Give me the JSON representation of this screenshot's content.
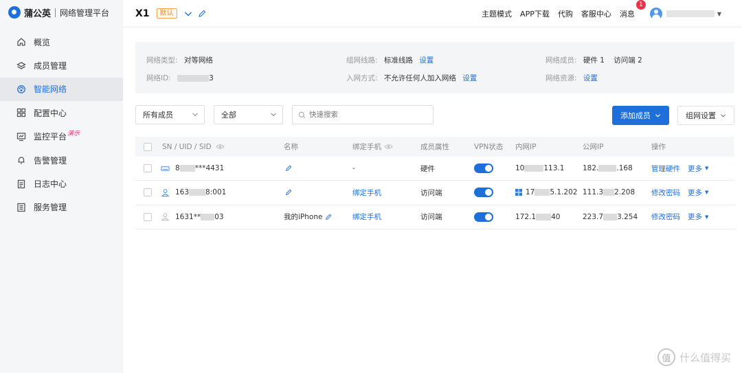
{
  "brand": {
    "name": "蒲公英",
    "subtitle": "网络管理平台"
  },
  "sidebar": {
    "items": [
      {
        "label": "概览",
        "icon": "home-icon"
      },
      {
        "label": "成员管理",
        "icon": "layers-icon"
      },
      {
        "label": "智能网络",
        "icon": "network-icon",
        "active": true
      },
      {
        "label": "配置中心",
        "icon": "grid-icon"
      },
      {
        "label": "监控平台",
        "icon": "monitor-icon",
        "badge": "演示"
      },
      {
        "label": "告警管理",
        "icon": "bell-icon"
      },
      {
        "label": "日志中心",
        "icon": "log-icon"
      },
      {
        "label": "服务管理",
        "icon": "service-icon"
      }
    ]
  },
  "header": {
    "network_name": "X1",
    "default_tag": "默认",
    "links": [
      "主题模式",
      "APP下载",
      "代购",
      "客服中心"
    ],
    "messages_label": "消息",
    "messages_count": "1"
  },
  "info": {
    "network_type_label": "网络类型:",
    "network_type_value": "对等网络",
    "network_id_label": "网络ID:",
    "network_id_suffix": "3",
    "route_label": "组网线路:",
    "route_value": "标准线路",
    "route_action": "设置",
    "join_label": "入网方式:",
    "join_value": "不允许任何人加入网络",
    "join_action": "设置",
    "members_label": "网络成员:",
    "members_hw": "硬件 1",
    "members_visitor": "访问端 2",
    "resources_label": "网络资源:",
    "resources_action": "设置"
  },
  "filters": {
    "member_select": "所有成员",
    "status_select": "全部",
    "search_placeholder": "快速搜索",
    "add_member": "添加成员",
    "group_settings": "组网设置"
  },
  "table": {
    "headers": {
      "sn": "SN / UID / SID",
      "name": "名称",
      "phone": "绑定手机",
      "attr": "成员属性",
      "vpn": "VPN状态",
      "lan_ip": "内网IP",
      "wan_ip": "公网IP",
      "ops": "操作"
    },
    "rows": [
      {
        "sn_a": "8",
        "sn_b": "***4431",
        "name": "",
        "phone": "-",
        "attr": "硬件",
        "lan_a": "10",
        "lan_b": "113.1",
        "wan_a": "182.",
        "wan_b": ".168",
        "op1": "管理硬件",
        "op2": "更多"
      },
      {
        "sn_a": "163",
        "sn_b": "8:001",
        "name": "",
        "phone": "绑定手机",
        "attr": "访问端",
        "lan_a": "17",
        "lan_b": "5.1.202",
        "wan_a": "111.3",
        "wan_b": "2.208",
        "op1": "修改密码",
        "op2": "更多"
      },
      {
        "sn_a": "1631**",
        "sn_b": "03",
        "name": "我的iPhone",
        "phone": "绑定手机",
        "attr": "访问端",
        "lan_a": "172.1",
        "lan_b": "40",
        "wan_a": "223.7",
        "wan_b": "3.254",
        "op1": "修改密码",
        "op2": "更多"
      }
    ]
  },
  "watermark": {
    "glyph": "值",
    "text": "什么值得买"
  },
  "colors": {
    "primary": "#1e6fd9",
    "sidebar_bg": "#f5f6f7",
    "tag_orange": "#f08c1c",
    "badge_red": "#e8334a"
  }
}
